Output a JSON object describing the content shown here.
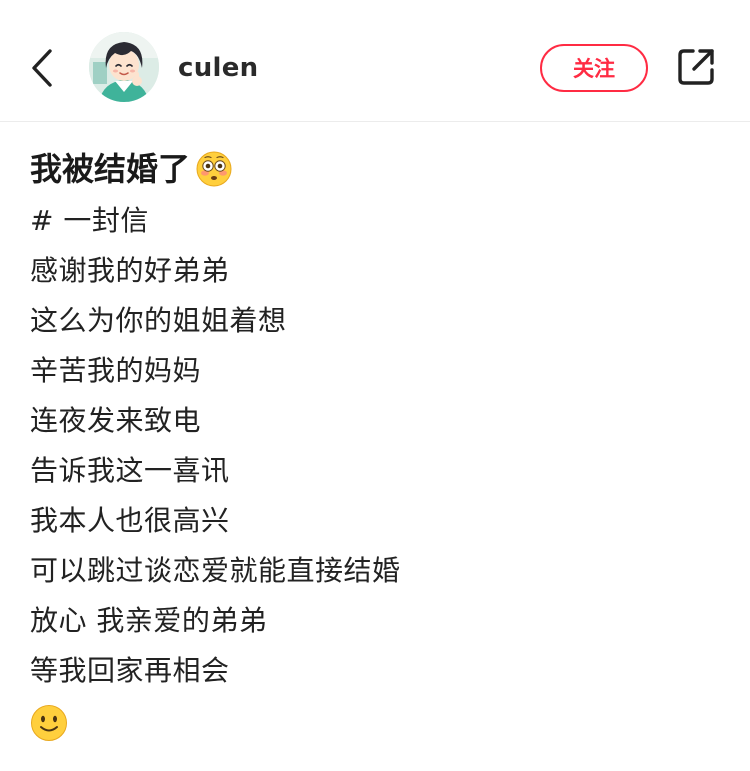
{
  "header": {
    "back_icon": "chevron-left-icon",
    "username": "culen",
    "follow_label": "关注",
    "share_icon": "share-external-icon",
    "accent_color": "#ff2b43"
  },
  "post": {
    "title": "我被结婚了",
    "title_emoji": "flushed-face",
    "lines": [
      "# 一封信",
      "感谢我的好弟弟",
      "这么为你的姐姐着想",
      "辛苦我的妈妈",
      "连夜发来致电",
      "告诉我这一喜讯",
      "我本人也很高兴",
      "可以跳过谈恋爱就能直接结婚",
      "放心 我亲爱的弟弟",
      "等我回家再相会"
    ],
    "end_emoji": "slightly-smiling-face"
  }
}
